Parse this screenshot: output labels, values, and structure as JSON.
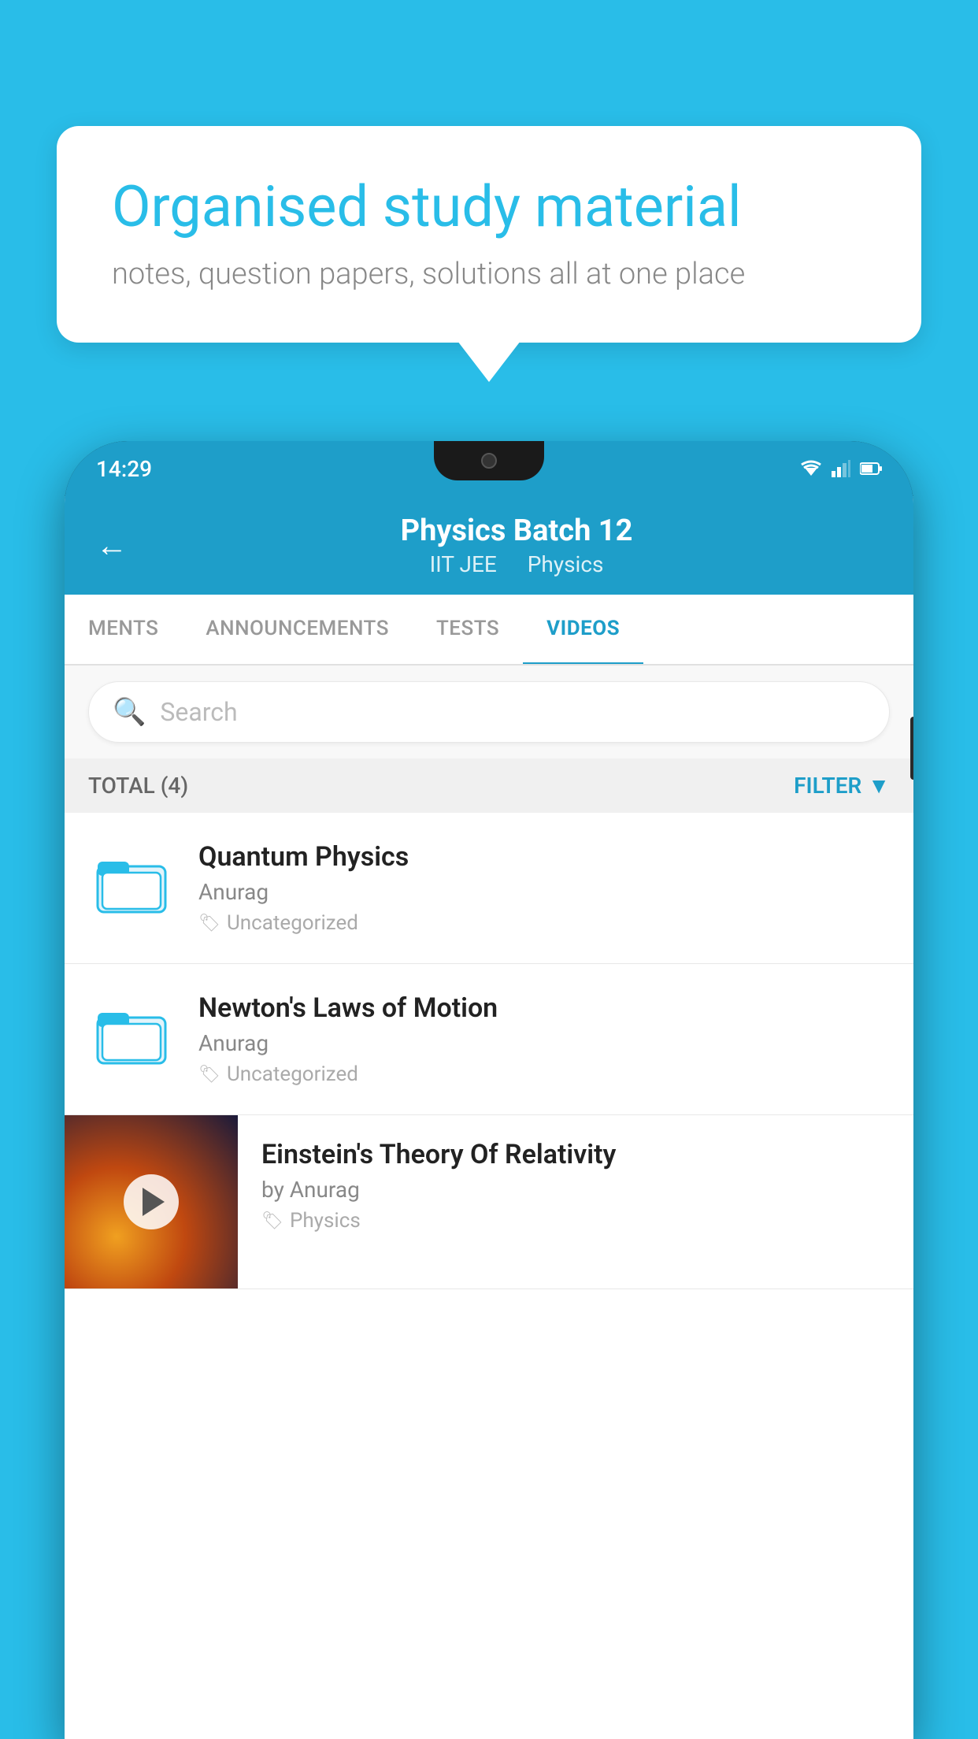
{
  "bubble": {
    "title": "Organised study material",
    "subtitle": "notes, question papers, solutions all at one place"
  },
  "status_bar": {
    "time": "14:29"
  },
  "header": {
    "title": "Physics Batch 12",
    "subtitle_parts": [
      "IIT JEE",
      "Physics"
    ],
    "back_label": "←"
  },
  "tabs": [
    {
      "label": "MENTS",
      "active": false
    },
    {
      "label": "ANNOUNCEMENTS",
      "active": false
    },
    {
      "label": "TESTS",
      "active": false
    },
    {
      "label": "VIDEOS",
      "active": true
    }
  ],
  "search": {
    "placeholder": "Search"
  },
  "filter_row": {
    "total_label": "TOTAL (4)",
    "filter_label": "FILTER"
  },
  "videos": [
    {
      "title": "Quantum Physics",
      "author": "Anurag",
      "tag": "Uncategorized",
      "type": "folder"
    },
    {
      "title": "Newton's Laws of Motion",
      "author": "Anurag",
      "tag": "Uncategorized",
      "type": "folder"
    },
    {
      "title": "Einstein's Theory Of Relativity",
      "author": "by Anurag",
      "tag": "Physics",
      "type": "video"
    }
  ]
}
